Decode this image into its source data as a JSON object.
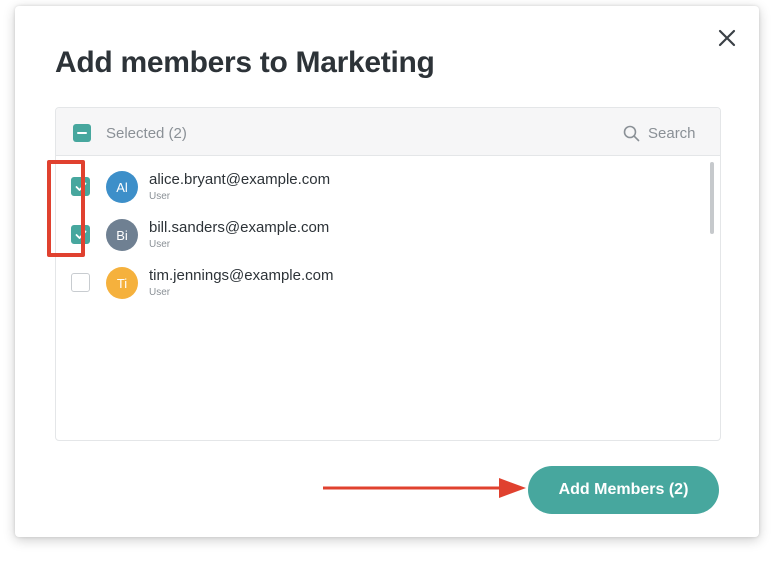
{
  "dialog": {
    "title": "Add members to Marketing",
    "close_icon": "close-icon"
  },
  "list": {
    "header": {
      "selected_label": "Selected (2)",
      "search_label": "Search",
      "search_icon": "search-icon"
    },
    "members": [
      {
        "initials": "Al",
        "email": "alice.bryant@example.com",
        "role": "User",
        "checked": true,
        "avatar_color": "#3d8fc9"
      },
      {
        "initials": "Bi",
        "email": "bill.sanders@example.com",
        "role": "User",
        "checked": true,
        "avatar_color": "#6f8092"
      },
      {
        "initials": "Ti",
        "email": "tim.jennings@example.com",
        "role": "User",
        "checked": false,
        "avatar_color": "#f5b13d"
      }
    ]
  },
  "footer": {
    "add_button_label": "Add Members (2)"
  },
  "colors": {
    "accent": "#47a79e",
    "annotation": "#e0412f",
    "title_text": "#2d3338",
    "muted_text": "#8a9096"
  }
}
